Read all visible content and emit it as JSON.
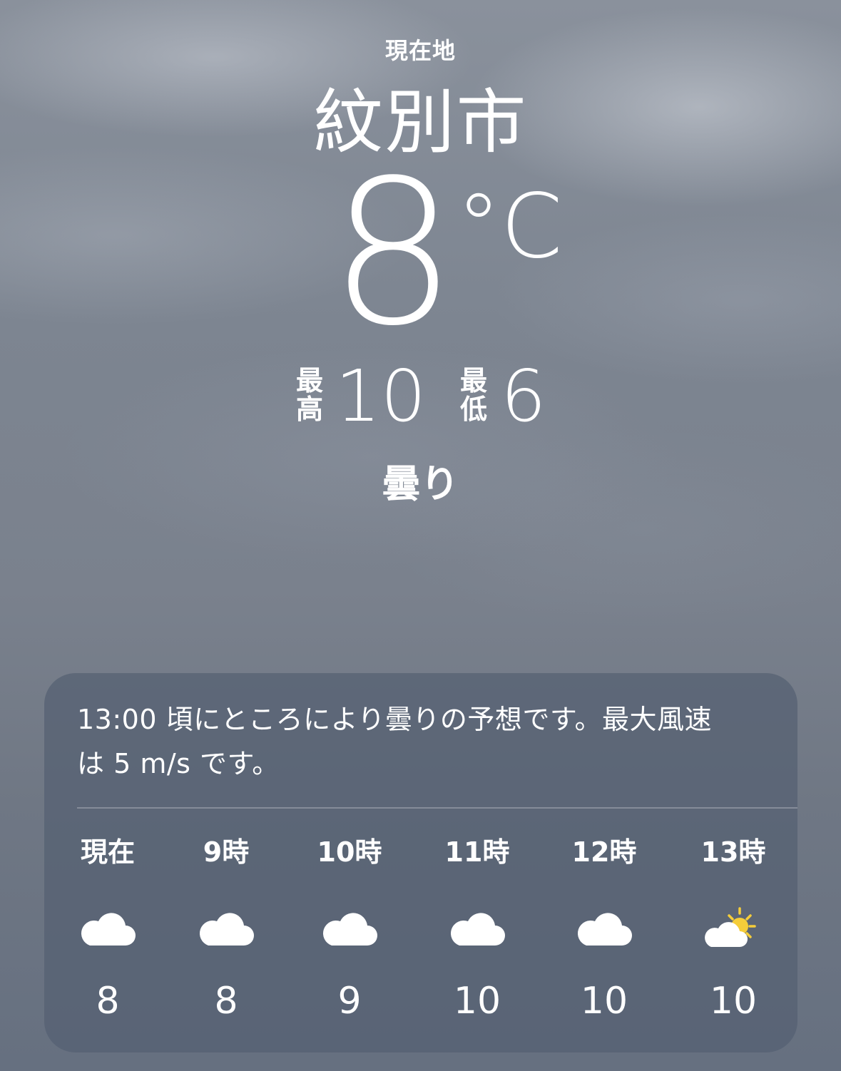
{
  "location": {
    "label": "現在地",
    "city": "紋別市"
  },
  "current": {
    "temperature": "8",
    "unit": "°C",
    "high_label": "最\n高",
    "high": "10",
    "low_label": "最\n低",
    "low": "6",
    "condition": "曇り"
  },
  "forecast_card": {
    "summary": "13:00 頃にところにより曇りの予想です。最大風速は 5 m/s です。",
    "hours": [
      {
        "time": "現在",
        "icon": "cloud-icon",
        "temp": "8"
      },
      {
        "time": "9時",
        "icon": "cloud-icon",
        "temp": "8"
      },
      {
        "time": "10時",
        "icon": "cloud-icon",
        "temp": "9"
      },
      {
        "time": "11時",
        "icon": "cloud-icon",
        "temp": "10"
      },
      {
        "time": "12時",
        "icon": "cloud-icon",
        "temp": "10"
      },
      {
        "time": "13時",
        "icon": "partly-sunny-icon",
        "temp": "10"
      }
    ]
  },
  "colors": {
    "sun": "#f5cd3a",
    "card_bg": "#546071"
  }
}
